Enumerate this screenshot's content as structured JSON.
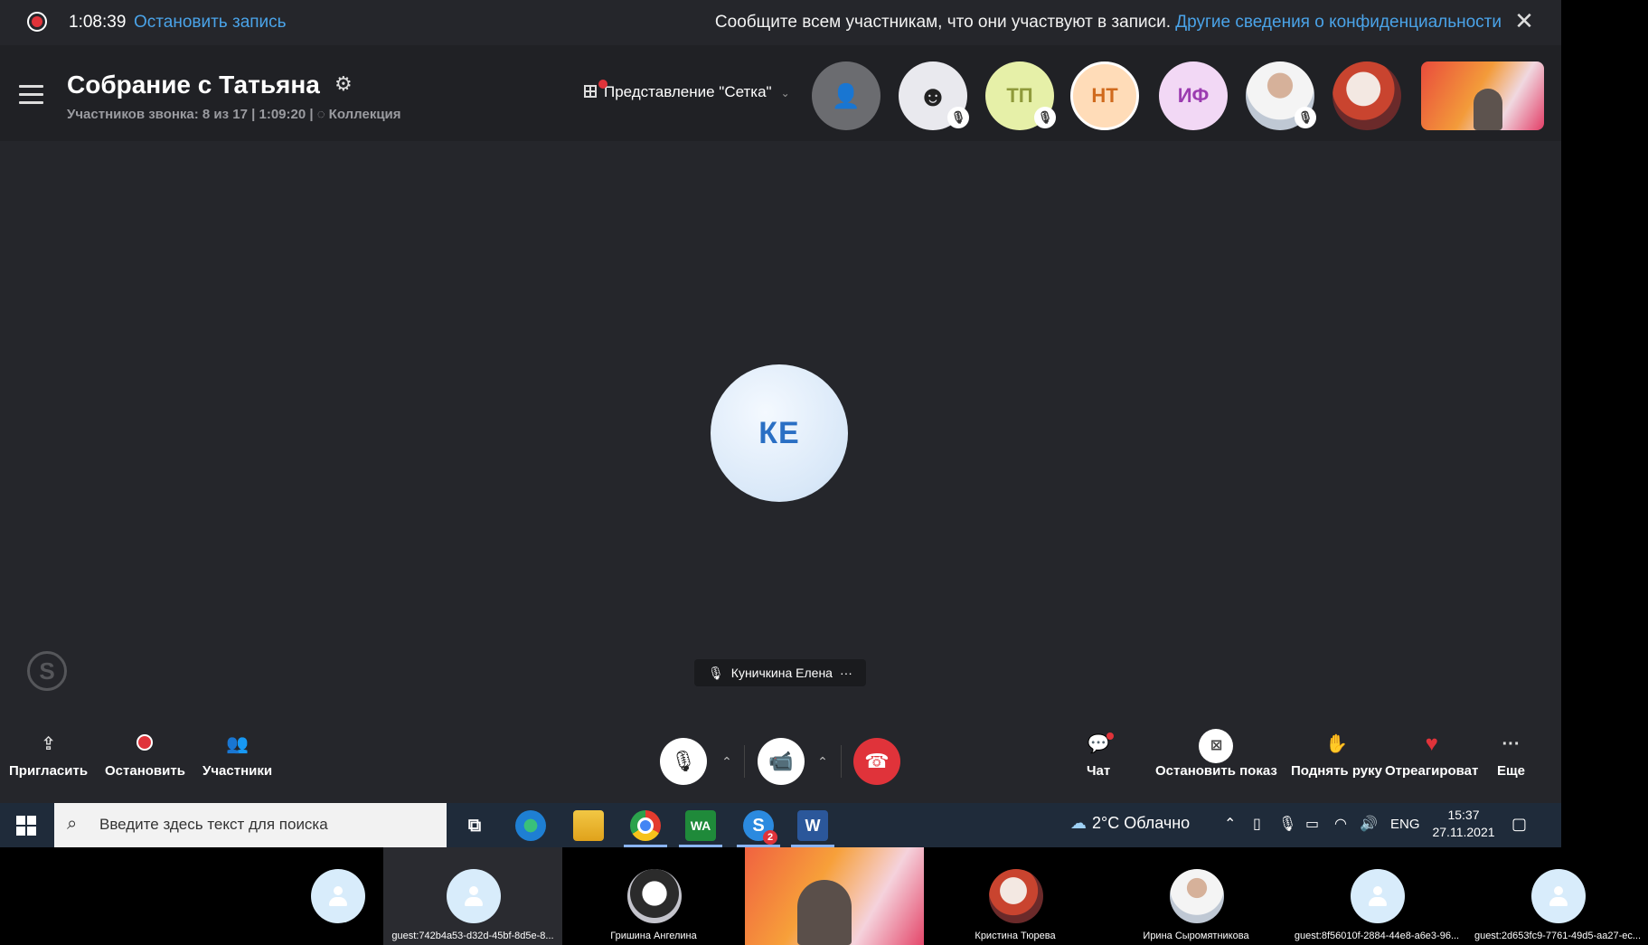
{
  "recording": {
    "time": "1:08:39",
    "stop_label": "Остановить запись",
    "notice": "Сообщите всем участникам, что они участвуют в записи.",
    "privacy_link": "Другие сведения о конфиденциальности"
  },
  "header": {
    "title": "Собрание с Татьяна",
    "subtitle": "Участников звонка: 8 из 17 | 1:09:20 |",
    "collection": "Коллекция",
    "view_label": "Представление \"Сетка\"",
    "avatars": [
      "ТП",
      "НТ",
      "ИФ"
    ]
  },
  "stage": {
    "speaker_initials": "КЕ",
    "speaker_name": "Куничкина Елена"
  },
  "toolbar": {
    "invite": "Пригласить",
    "stop": "Остановить",
    "participants": "Участники",
    "chat": "Чат",
    "stop_share": "Остановить показ",
    "raise_hand": "Поднять руку",
    "react": "Отреагироват",
    "more": "Еще"
  },
  "taskbar": {
    "search_placeholder": "Введите здесь текст для поиска",
    "weather": "2°C  Облачно",
    "lang": "ENG",
    "time": "15:37",
    "date": "27.11.2021",
    "skype_badge": "2",
    "wa_label": "WA",
    "word_label": "W"
  },
  "strip": {
    "names": [
      "guest:742b4a53-d32d-45bf-8d5e-8...",
      "Гришина Ангелина",
      "Кристина Тюрева",
      "Ирина Сыромятникова",
      "guest:8f56010f-2884-44e8-a6e3-96...",
      "guest:2d653fc9-7761-49d5-aa27-ec..."
    ]
  },
  "colors": {
    "background": "#25262b",
    "accent": "#4aa3e8",
    "danger": "#e0333a"
  }
}
